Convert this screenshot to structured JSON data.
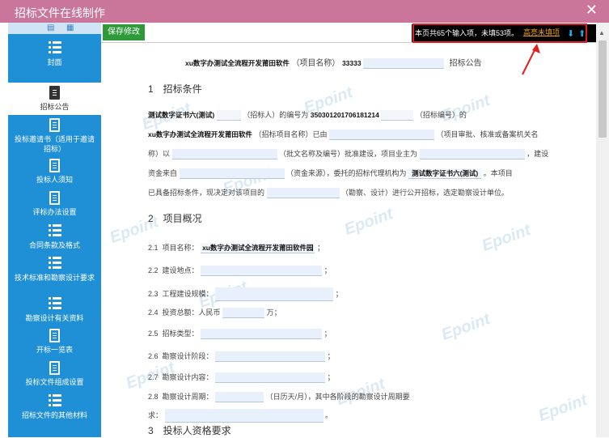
{
  "window": {
    "title": "招标文件在线制作"
  },
  "sidebar": {
    "items": [
      {
        "label": "封面"
      },
      {
        "label": "招标公告"
      },
      {
        "label": "投标邀请书（适用于邀请招标）"
      },
      {
        "label": "投标人须知"
      },
      {
        "label": "评标办法设置"
      },
      {
        "label": "合同条款及格式"
      },
      {
        "label": "技术标准和勘察设计要求"
      },
      {
        "label": "勘察设计有关资料"
      },
      {
        "label": "开标一览表"
      },
      {
        "label": "投标文件组成设置"
      },
      {
        "label": "招标文件的其他材料"
      }
    ]
  },
  "toolbar": {
    "save_label": "保存修改",
    "info_text": "本页共65个输入项，未填53项。",
    "highlight_link": "高亮未填项"
  },
  "doc": {
    "title_name": "xu数字办测试全流程开发莆田软件",
    "title_label": "（项目名称）",
    "title_code": "33333",
    "title_suffix": "招标公告",
    "s1_heading": "1　招标条件",
    "s1_tenderer": "测试数字证书六(测试)",
    "s1_t1": "（招标人）的编号为",
    "s1_number": "350301201706181214",
    "s1_t2": "（招标编号）的",
    "s1_project": "xu数字办测试全流程开发莆田软件",
    "s1_t3": "（招标项目名称）已由",
    "s1_t4": "（项目审批、核准或备案机关名",
    "s1_t5": "称）以",
    "s1_t6": "（批文名称及编号）批准建设，项目业主为",
    "s1_t7": "，建设",
    "s1_t8": "资金来自",
    "s1_t9": "（资金来源），委托的招标代理机构为",
    "s1_agent": "测试数字证书六(测试)",
    "s1_t10": "。本项目",
    "s1_t11": "已具备招标条件，现决定对该项目的",
    "s1_t12": "（勘察、设计）进行公开招标，选定勘察设计单位。",
    "s2_heading": "2　项目概况",
    "l21_no": "2.1",
    "l21_label": "项目名称：",
    "l21_value": "xu数字办测试全流程开发莆田软件园",
    "l22_no": "2.2",
    "l22_label": "建设地点：",
    "l23_no": "2.3",
    "l23_label": "工程建设规模：",
    "l24_no": "2.4",
    "l24_label": "投资总额：人民币",
    "l24_unit": "万；",
    "l25_no": "2.5",
    "l25_label": "招标类型：",
    "l26_no": "2.6",
    "l26_label": "勘察设计阶段：",
    "l27_no": "2.7",
    "l27_label": "勘察设计内容：",
    "l28_no": "2.8",
    "l28_label": "勘察设计周期：",
    "l28_t2": "（日历天/月），其中各阶段的勘察设计周期要",
    "l28_t3": "求：",
    "s3_heading": "3　投标人资格要求",
    "semicolon": "；",
    "period": "。",
    "watermark": "Epoint"
  }
}
